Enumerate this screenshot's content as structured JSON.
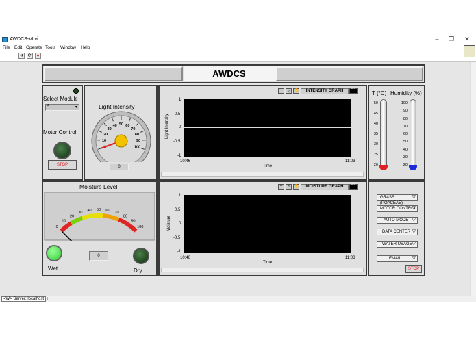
{
  "window": {
    "title": "AWDCS-VI.vi",
    "controls": [
      "–",
      "❐",
      "✕"
    ]
  },
  "menu": [
    "File",
    "Edit",
    "Operate",
    "Tools",
    "Window",
    "Help"
  ],
  "toolbar": {
    "run": "➔",
    "continuous": "⟳",
    "abort": "●"
  },
  "header": {
    "title": "AWDCS"
  },
  "module": {
    "label": "Select Module",
    "value": "5"
  },
  "motor": {
    "label": "Motor Control",
    "stop": "STOP"
  },
  "light": {
    "label": "Light Intensity",
    "value": "0",
    "needle": 0,
    "ticks": [
      "0",
      "10",
      "20",
      "30",
      "40",
      "50",
      "60",
      "70",
      "80",
      "90",
      "100"
    ]
  },
  "intensity_graph": {
    "title": "INTENSITY GRAPH",
    "ylabel": "Light Intensity",
    "xlabel": "Time",
    "yticks": [
      "1",
      "0.5",
      "0",
      "-0.5",
      "-1"
    ],
    "xstart": "10:46",
    "xend": "11:03"
  },
  "moisture_graph": {
    "title": "MOISTURE GRAPH",
    "ylabel": "Moisture",
    "xlabel": "Time",
    "yticks": [
      "1",
      "0.5",
      "0",
      "-0.5",
      "-1"
    ],
    "xstart": "10:46",
    "xend": "11:03"
  },
  "moisture": {
    "label": "Moisture Level",
    "value": "0",
    "needle": 0,
    "ticks": [
      "0",
      "10",
      "20",
      "30",
      "40",
      "50",
      "60",
      "70",
      "80",
      "90",
      "100"
    ],
    "wet": "Wet",
    "dry": "Dry"
  },
  "temp": {
    "label": "T (°C)",
    "ticks": [
      "50",
      "45",
      "40",
      "35",
      "30",
      "25",
      "20"
    ],
    "level": 0
  },
  "humidity": {
    "label": "Humidity (%)",
    "ticks": [
      "100",
      "90",
      "80",
      "70",
      "60",
      "50",
      "40",
      "30",
      "20"
    ],
    "level": 0
  },
  "nav": [
    "GRASS (POACEAE)",
    "MOTOR CONTROL",
    "AUTO MODE",
    "DATA CENTER",
    "WATER USAGE",
    "EMAIL"
  ],
  "nav_stop": "STOP",
  "status": {
    "server": "<W> Server: localhost"
  },
  "colors": {
    "led_on": "#39e83a",
    "led_off": "#1d4a1d",
    "graph_bg": "#000000",
    "stop_text": "#e02020"
  }
}
